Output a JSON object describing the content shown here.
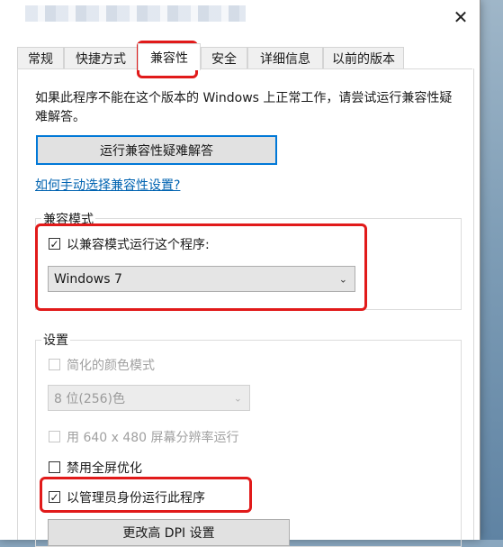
{
  "window": {
    "close_glyph": "✕"
  },
  "tabs": [
    {
      "label": "常规"
    },
    {
      "label": "快捷方式"
    },
    {
      "label": "兼容性"
    },
    {
      "label": "安全"
    },
    {
      "label": "详细信息"
    },
    {
      "label": "以前的版本"
    }
  ],
  "compat": {
    "intro": "如果此程序不能在这个版本的 Windows 上正常工作，请尝试运行兼容性疑难解答。",
    "troubleshoot_button": "运行兼容性疑难解答",
    "manual_link": "如何手动选择兼容性设置?",
    "mode_group_label": "兼容模式",
    "mode_checkbox_label": "以兼容模式运行这个程序:",
    "mode_checked": true,
    "mode_select_value": "Windows 7"
  },
  "settings": {
    "group_label": "设置",
    "reduced_color_label": "简化的颜色模式",
    "color_select_value": "8 位(256)色",
    "resolution_label": "用 640 x 480 屏幕分辨率运行",
    "fullscreen_label": "禁用全屏优化",
    "admin_label": "以管理员身份运行此程序",
    "admin_checked": true,
    "dpi_button": "更改高 DPI 设置"
  },
  "colors": {
    "highlight": "#e11a1a",
    "link": "#0063b1",
    "accent": "#0078d7"
  }
}
